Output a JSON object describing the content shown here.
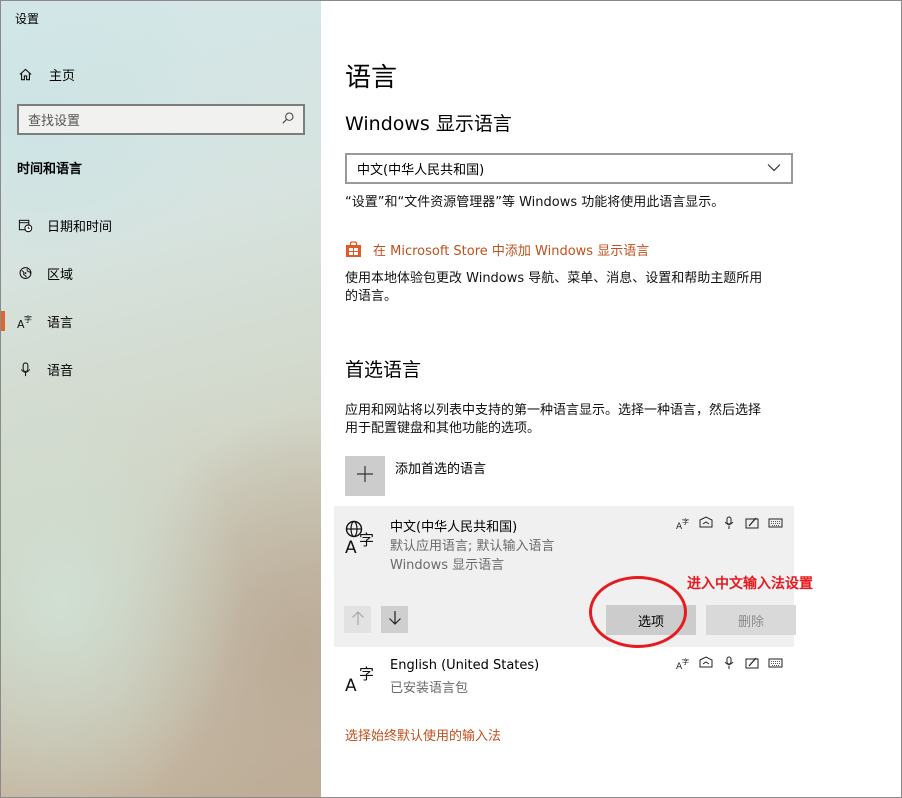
{
  "window": {
    "title": "设置"
  },
  "sidebar": {
    "home_label": "主页",
    "search": {
      "placeholder": "查找设置"
    },
    "section_title": "时间和语言",
    "items": [
      {
        "label": "日期和时间",
        "icon": "calendar-clock-icon",
        "active": false
      },
      {
        "label": "区域",
        "icon": "globe-region-icon",
        "active": false
      },
      {
        "label": "语言",
        "icon": "language-icon",
        "active": true
      },
      {
        "label": "语音",
        "icon": "microphone-icon",
        "active": false
      }
    ],
    "accent_color": "#e06531"
  },
  "main": {
    "title": "语言",
    "display_language": {
      "heading": "Windows 显示语言",
      "selected": "中文(中华人民共和国)",
      "description": "“设置”和“文件资源管理器”等 Windows 功能将使用此语言显示。",
      "store_link": "在 Microsoft Store 中添加 Windows 显示语言",
      "store_description_line1": "使用本地体验包更改 Windows 导航、菜单、消息、设置和帮助主题所用",
      "store_description_line2": "的语言。"
    },
    "preferred": {
      "heading": "首选语言",
      "description_line1": "应用和网站将以列表中支持的第一种语言显示。选择一种语言，然后选择",
      "description_line2": "用于配置键盘和其他功能的选项。",
      "add_label": "添加首选的语言",
      "languages": [
        {
          "name": "中文(中华人民共和国)",
          "sub1": "默认应用语言; 默认输入语言",
          "sub2": "Windows 显示语言",
          "selected": true
        },
        {
          "name": "English (United States)",
          "sub1": "已安装语言包",
          "selected": false
        }
      ],
      "options_label": "选项",
      "remove_label": "删除"
    },
    "bottom_link": "选择始终默认使用的输入法",
    "link_color": "#c0501c"
  },
  "annotation": {
    "text": "进入中文输入法设置",
    "color": "#e8191f"
  }
}
